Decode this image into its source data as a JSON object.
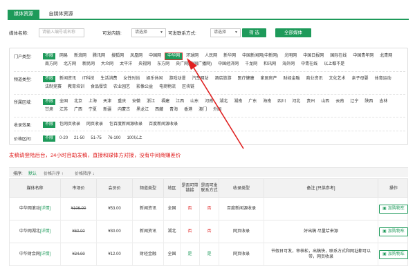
{
  "tabs": [
    {
      "label": "媒体资源",
      "active": true
    },
    {
      "label": "自媒体资源",
      "active": false
    }
  ],
  "search": {
    "name_label": "媒体名称:",
    "name_placeholder": "请输入编号或名称",
    "link_label": "可发内链:",
    "link_value": "请选择",
    "contact_label": "可发联系方式:",
    "contact_value": "请选择",
    "filter_button": "筛 选",
    "all_button": "全部媒体"
  },
  "filters": {
    "portal": {
      "label": "门户类型:",
      "items": [
        "不限",
        "网易",
        "新浪网",
        "腾讯网",
        "搜狐网",
        "凤凰网",
        "中国网",
        "中华网",
        "环球网",
        "人民网",
        "新华网",
        "中国新闻网(中新网)",
        "光明网",
        "中国日报网",
        "国际在线",
        "中国青年网",
        "北青网",
        "南方网",
        "北方网",
        "新民网",
        "大众网",
        "太平洋",
        "央视网",
        "东方网",
        "央广网(中国广播网)",
        "中国经济网",
        "千龙网",
        "和讯网",
        "海外网",
        "中青在线",
        "以上都不是"
      ],
      "active_index": 0,
      "highlight_index": 7
    },
    "channel": {
      "label": "频道类型:",
      "items": [
        "不限",
        "新闻资讯",
        "IT科技",
        "生活消费",
        "女性时尚",
        "娱乐休闲",
        "游戏动漫",
        "汽车网站",
        "酒店旅游",
        "医疗健康",
        "家居房产",
        "财经金融",
        "商业资讯",
        "文化艺术",
        "亲子母婴",
        "体育运动",
        "法制竞赛",
        "教育培训",
        "食品餐饮",
        "农业园艺",
        "影像公益",
        "电商物流",
        "区块链"
      ],
      "active_index": 0
    },
    "region": {
      "label": "所属区域:",
      "items": [
        "不限",
        "全国",
        "北京",
        "上海",
        "天津",
        "重庆",
        "安徽",
        "浙江",
        "福建",
        "江西",
        "山东",
        "河南",
        "湖北",
        "湖南",
        "广东",
        "海南",
        "四川",
        "河北",
        "贵州",
        "山西",
        "云南",
        "辽宁",
        "陕西",
        "吉林",
        "甘肃",
        "江苏",
        "广西",
        "宁夏",
        "新疆",
        "内蒙古",
        "黑龙江",
        "西藏",
        "青海",
        "香港",
        "澳门",
        "外国"
      ],
      "active_index": 0
    },
    "inclusion": {
      "label": "收录效果:",
      "items": [
        "不限",
        "包网页收录",
        "网页收录",
        "包百度新闻源收录",
        "百度新闻源收录"
      ],
      "active_index": 0
    },
    "price": {
      "label": "价格区间:",
      "items": [
        "不限",
        "0-20",
        "21-50",
        "51-75",
        "76-100",
        "100以上"
      ],
      "active_index": 0
    }
  },
  "notice": "发稿请登陆后台，24小时自助发稿，直接和媒体方对接，没有中间商赚差价",
  "sort": {
    "label": "排序:",
    "default": "默认",
    "price_asc": "价格升序 ↑",
    "price_desc": "价格降序 ↓"
  },
  "table": {
    "headers": [
      "媒体名称",
      "市场价",
      "会员价",
      "频道类型",
      "地区",
      "是否可带链接",
      "是否可发联系方式",
      "收录类型",
      "备注 [只供参考]",
      "操作"
    ],
    "rows": [
      {
        "name": "中华网滚动",
        "detail": "[详情]",
        "market": "¥106.00",
        "member": "¥53.00",
        "channel": "新闻资讯",
        "region": "全国",
        "link": "否",
        "contact": "否",
        "inclusion": "百度新闻源收录",
        "note": "",
        "action": "加购物车"
      },
      {
        "name": "中华网湖北",
        "detail": "[详情]",
        "market": "¥60.00",
        "member": "¥30.00",
        "channel": "新闻资讯",
        "region": "湖北",
        "link": "否",
        "contact": "否",
        "inclusion": "网页收录",
        "note": "好出稿 尽量给来源",
        "action": "加购物车"
      },
      {
        "name": "中华财会网",
        "detail": "[详情]",
        "market": "¥24.00",
        "member": "¥12.00",
        "channel": "财经金融",
        "region": "全国",
        "link": "是",
        "contact": "是",
        "inclusion": "网页收录",
        "note": "节假日可发，审核松，出稿快，联系方式和网址都可以带，网页收录",
        "action": "加购物车"
      }
    ]
  },
  "icons": {
    "cart": "cart-icon",
    "chevron": "chevron-down-icon",
    "arrow": "red-arrow-annotation"
  },
  "colors": {
    "accent": "#1e9a5a",
    "alert": "#e02020"
  }
}
